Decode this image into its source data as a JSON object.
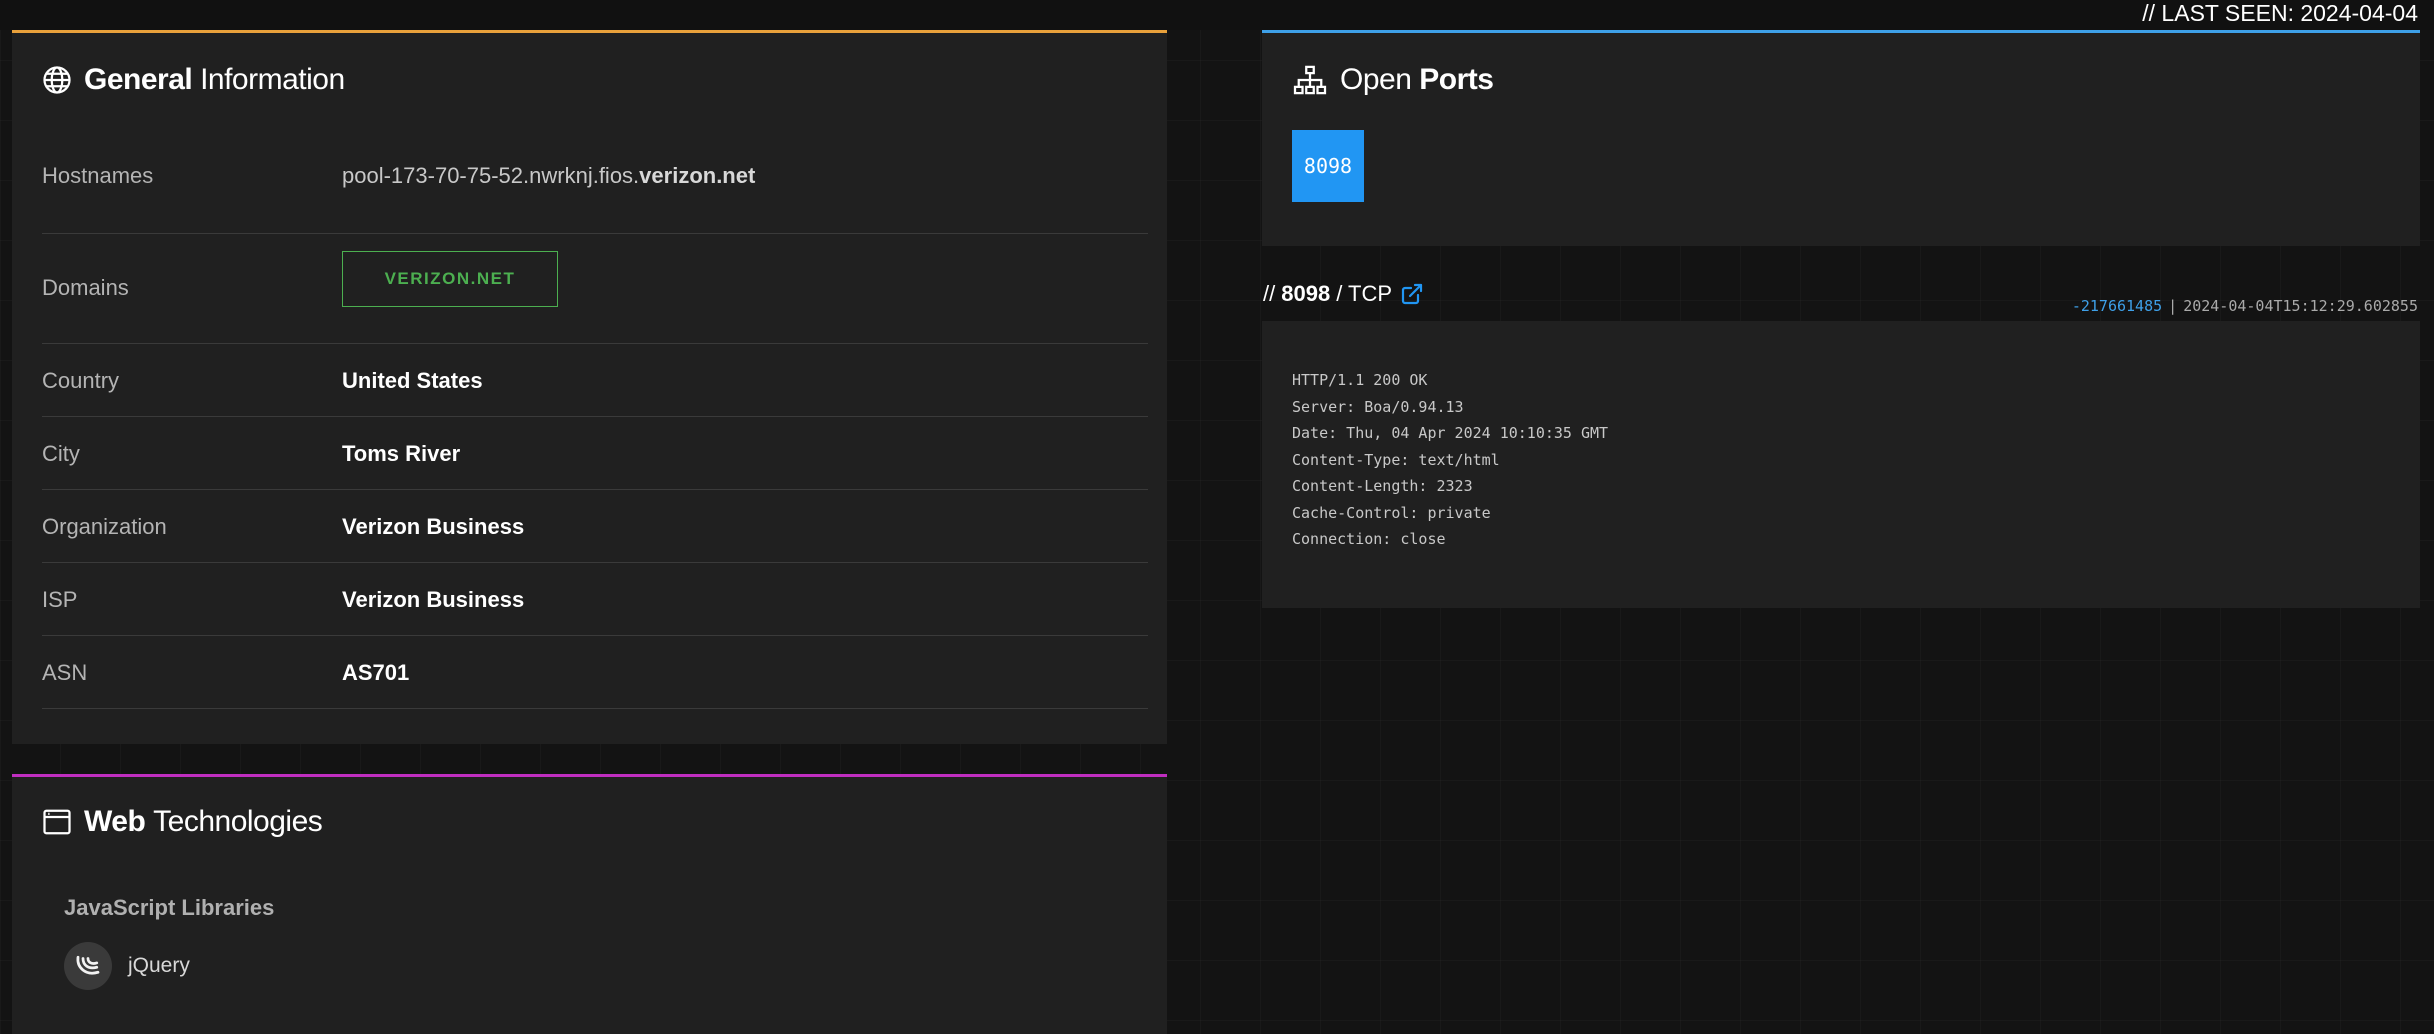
{
  "header": {
    "last_seen": "// LAST SEEN: 2024-04-04"
  },
  "general": {
    "title_bold": "General",
    "title_light": "Information",
    "rows": [
      {
        "label": "Hostnames",
        "value_prefix": "pool-173-70-75-52.nwrknj.fios.",
        "value_bold": "verizon.net"
      },
      {
        "label": "Domains",
        "badge": "VERIZON.NET"
      },
      {
        "label": "Country",
        "value": "United States"
      },
      {
        "label": "City",
        "value": "Toms River"
      },
      {
        "label": "Organization",
        "value": "Verizon Business"
      },
      {
        "label": "ISP",
        "value": "Verizon Business"
      },
      {
        "label": "ASN",
        "value": "AS701"
      }
    ]
  },
  "web": {
    "title_bold": "Web",
    "title_light": "Technologies",
    "section": "JavaScript Libraries",
    "items": [
      {
        "name": "jQuery",
        "icon": "jquery-icon"
      }
    ]
  },
  "ports": {
    "title_light": "Open",
    "title_bold": "Ports",
    "list": [
      "8098"
    ]
  },
  "service": {
    "prefix": "//",
    "port": "8098",
    "protocol": "/ TCP",
    "hash": "-217661485",
    "separator": "|",
    "timestamp": "2024-04-04T15:12:29.602855",
    "banner": "HTTP/1.1 200 OK\nServer: Boa/0.94.13\nDate: Thu, 04 Apr 2024 10:10:35 GMT\nContent-Type: text/html\nContent-Length: 2323\nCache-Control: private\nConnection: close"
  },
  "colors": {
    "accent_general": "#e9a13b",
    "accent_web": "#c02ec0",
    "accent_ports": "#3ea0e8",
    "port_badge": "#2196f3",
    "domain_badge": "#4caf50"
  }
}
